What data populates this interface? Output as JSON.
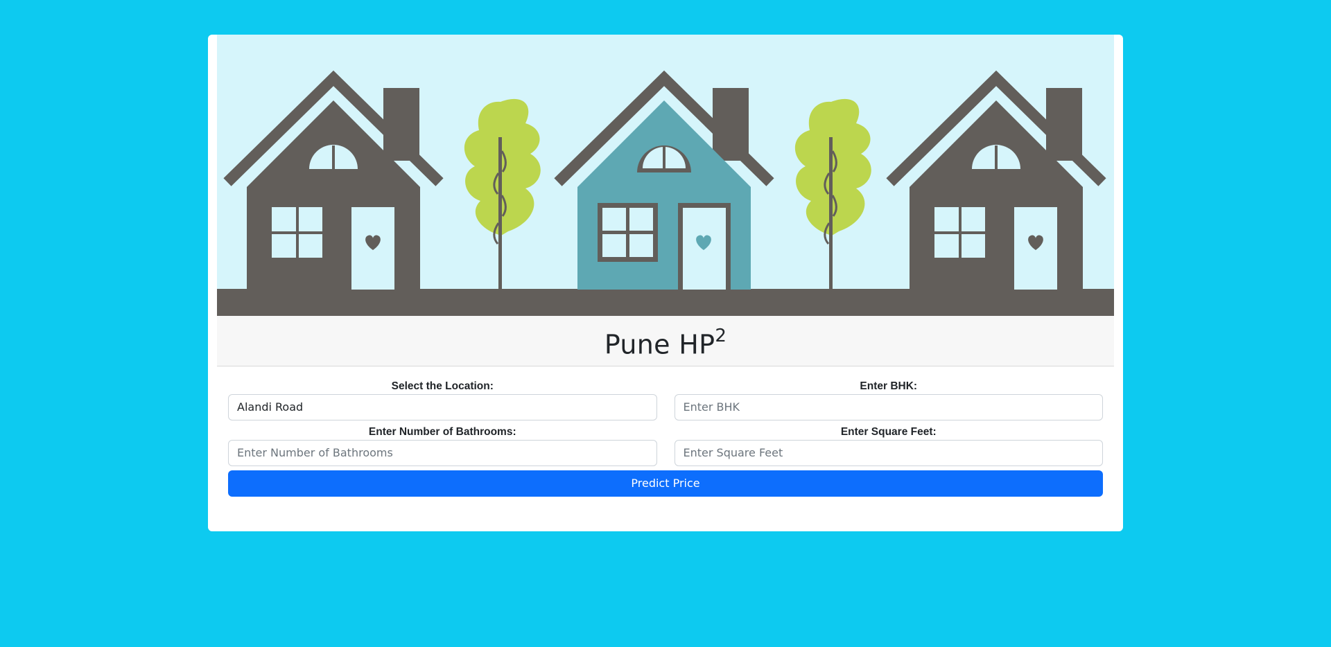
{
  "header": {
    "title": "Pune HP",
    "title_superscript": "2"
  },
  "form": {
    "location_label": "Select the Location:",
    "location_value": "Alandi Road",
    "bhk_label": "Enter BHK:",
    "bhk_placeholder": "Enter BHK",
    "bath_label": "Enter Number of Bathrooms:",
    "bath_placeholder": "Enter Number of Bathrooms",
    "sqft_label": "Enter Square Feet:",
    "sqft_placeholder": "Enter Square Feet",
    "submit_label": "Predict Price"
  },
  "colors": {
    "page_bg": "#0dcaf0",
    "banner_sky": "#d6f5fb",
    "house_gray": "#625e5a",
    "house_teal": "#5ea8b3",
    "tree_green": "#bcd64e",
    "button_blue": "#0d6efd"
  },
  "banner": {
    "image": "houses-illustration"
  }
}
